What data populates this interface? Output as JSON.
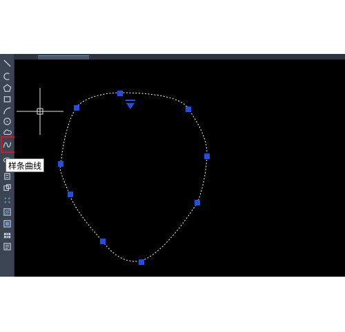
{
  "toolbar": {
    "tools": [
      {
        "name": "line-tool",
        "icon": "line-icon"
      },
      {
        "name": "arc-tool",
        "icon": "arc-icon"
      },
      {
        "name": "polygon-tool",
        "icon": "polygon-icon"
      },
      {
        "name": "rectangle-tool",
        "icon": "rectangle-icon"
      },
      {
        "name": "arc-3point-tool",
        "icon": "arc-3point-icon"
      },
      {
        "name": "circle-tool",
        "icon": "circle-icon"
      },
      {
        "name": "revision-cloud-tool",
        "icon": "cloud-icon"
      },
      {
        "name": "spline-tool",
        "icon": "spline-icon"
      },
      {
        "name": "ellipse-tool",
        "icon": "ellipse-icon"
      },
      {
        "name": "insert-block-tool",
        "icon": "insert-block-icon"
      },
      {
        "name": "create-block-tool",
        "icon": "create-block-icon"
      },
      {
        "name": "point-tool",
        "icon": "point-icon"
      },
      {
        "name": "hatch-tool",
        "icon": "hatch-icon"
      },
      {
        "name": "gradient-tool",
        "icon": "gradient-icon"
      },
      {
        "name": "table-tool",
        "icon": "table-icon"
      },
      {
        "name": "mtext-tool",
        "icon": "mtext-icon"
      }
    ],
    "active_tool": "spline-tool"
  },
  "tooltip": {
    "text": "样条曲线"
  },
  "colors": {
    "toolbar_bg": "#3b4453",
    "canvas_bg": "#000000",
    "icon": "#c9d3df",
    "grip": "#1f4fe8",
    "highlight": "#e0141e",
    "spline": "#ffffff"
  }
}
